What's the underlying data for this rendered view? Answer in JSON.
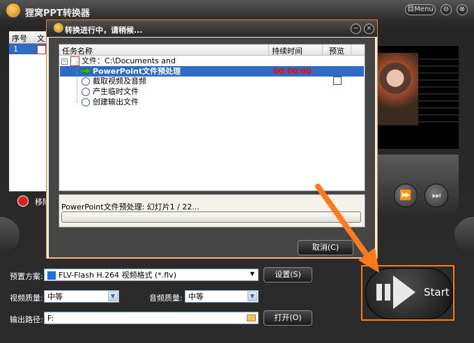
{
  "app": {
    "title": "狸窝PPT转换器",
    "menu_label": "目Menu",
    "minimize": "⊖",
    "close": "⊗"
  },
  "file_list": {
    "headers": [
      "序号",
      "文"
    ],
    "rows": [
      {
        "index": "1"
      }
    ],
    "remove_label": "移除"
  },
  "player": {
    "fast_forward": "⏩",
    "next": "⏭"
  },
  "dialog": {
    "title": "转换进行中，请稍候...",
    "columns": {
      "name": "任务名称",
      "duration": "持续时间",
      "preview": "预览"
    },
    "file_row": "文件：C:\\Documents and Settings\\Administrator\\桌面\\...",
    "tasks": [
      {
        "label": "PowerPoint文件预处理",
        "duration": "00:00:00"
      },
      {
        "label": "截取视频及音频"
      },
      {
        "label": "产生临时文件"
      },
      {
        "label": "创建输出文件"
      }
    ],
    "status_text": "PowerPoint文件预处理: 幻灯片1 / 22...",
    "progress": 0,
    "cancel_label": "取消(C)"
  },
  "settings": {
    "preset_label": "预置方案:",
    "preset_value": "FLV-Flash H.264 视频格式 (*.flv)",
    "settings_button": "设置(S)",
    "video_quality_label": "视频质量:",
    "video_quality_value": "中等",
    "audio_quality_label": "音频质量:",
    "audio_quality_value": "中等",
    "output_path_label": "输出路径:",
    "output_path_value": "F:",
    "open_button": "打开(O)"
  },
  "start": {
    "label": "Start"
  },
  "colors": {
    "accent": "#ff7a1a",
    "selection": "#316ac5",
    "duration_red": "#ff0000"
  }
}
